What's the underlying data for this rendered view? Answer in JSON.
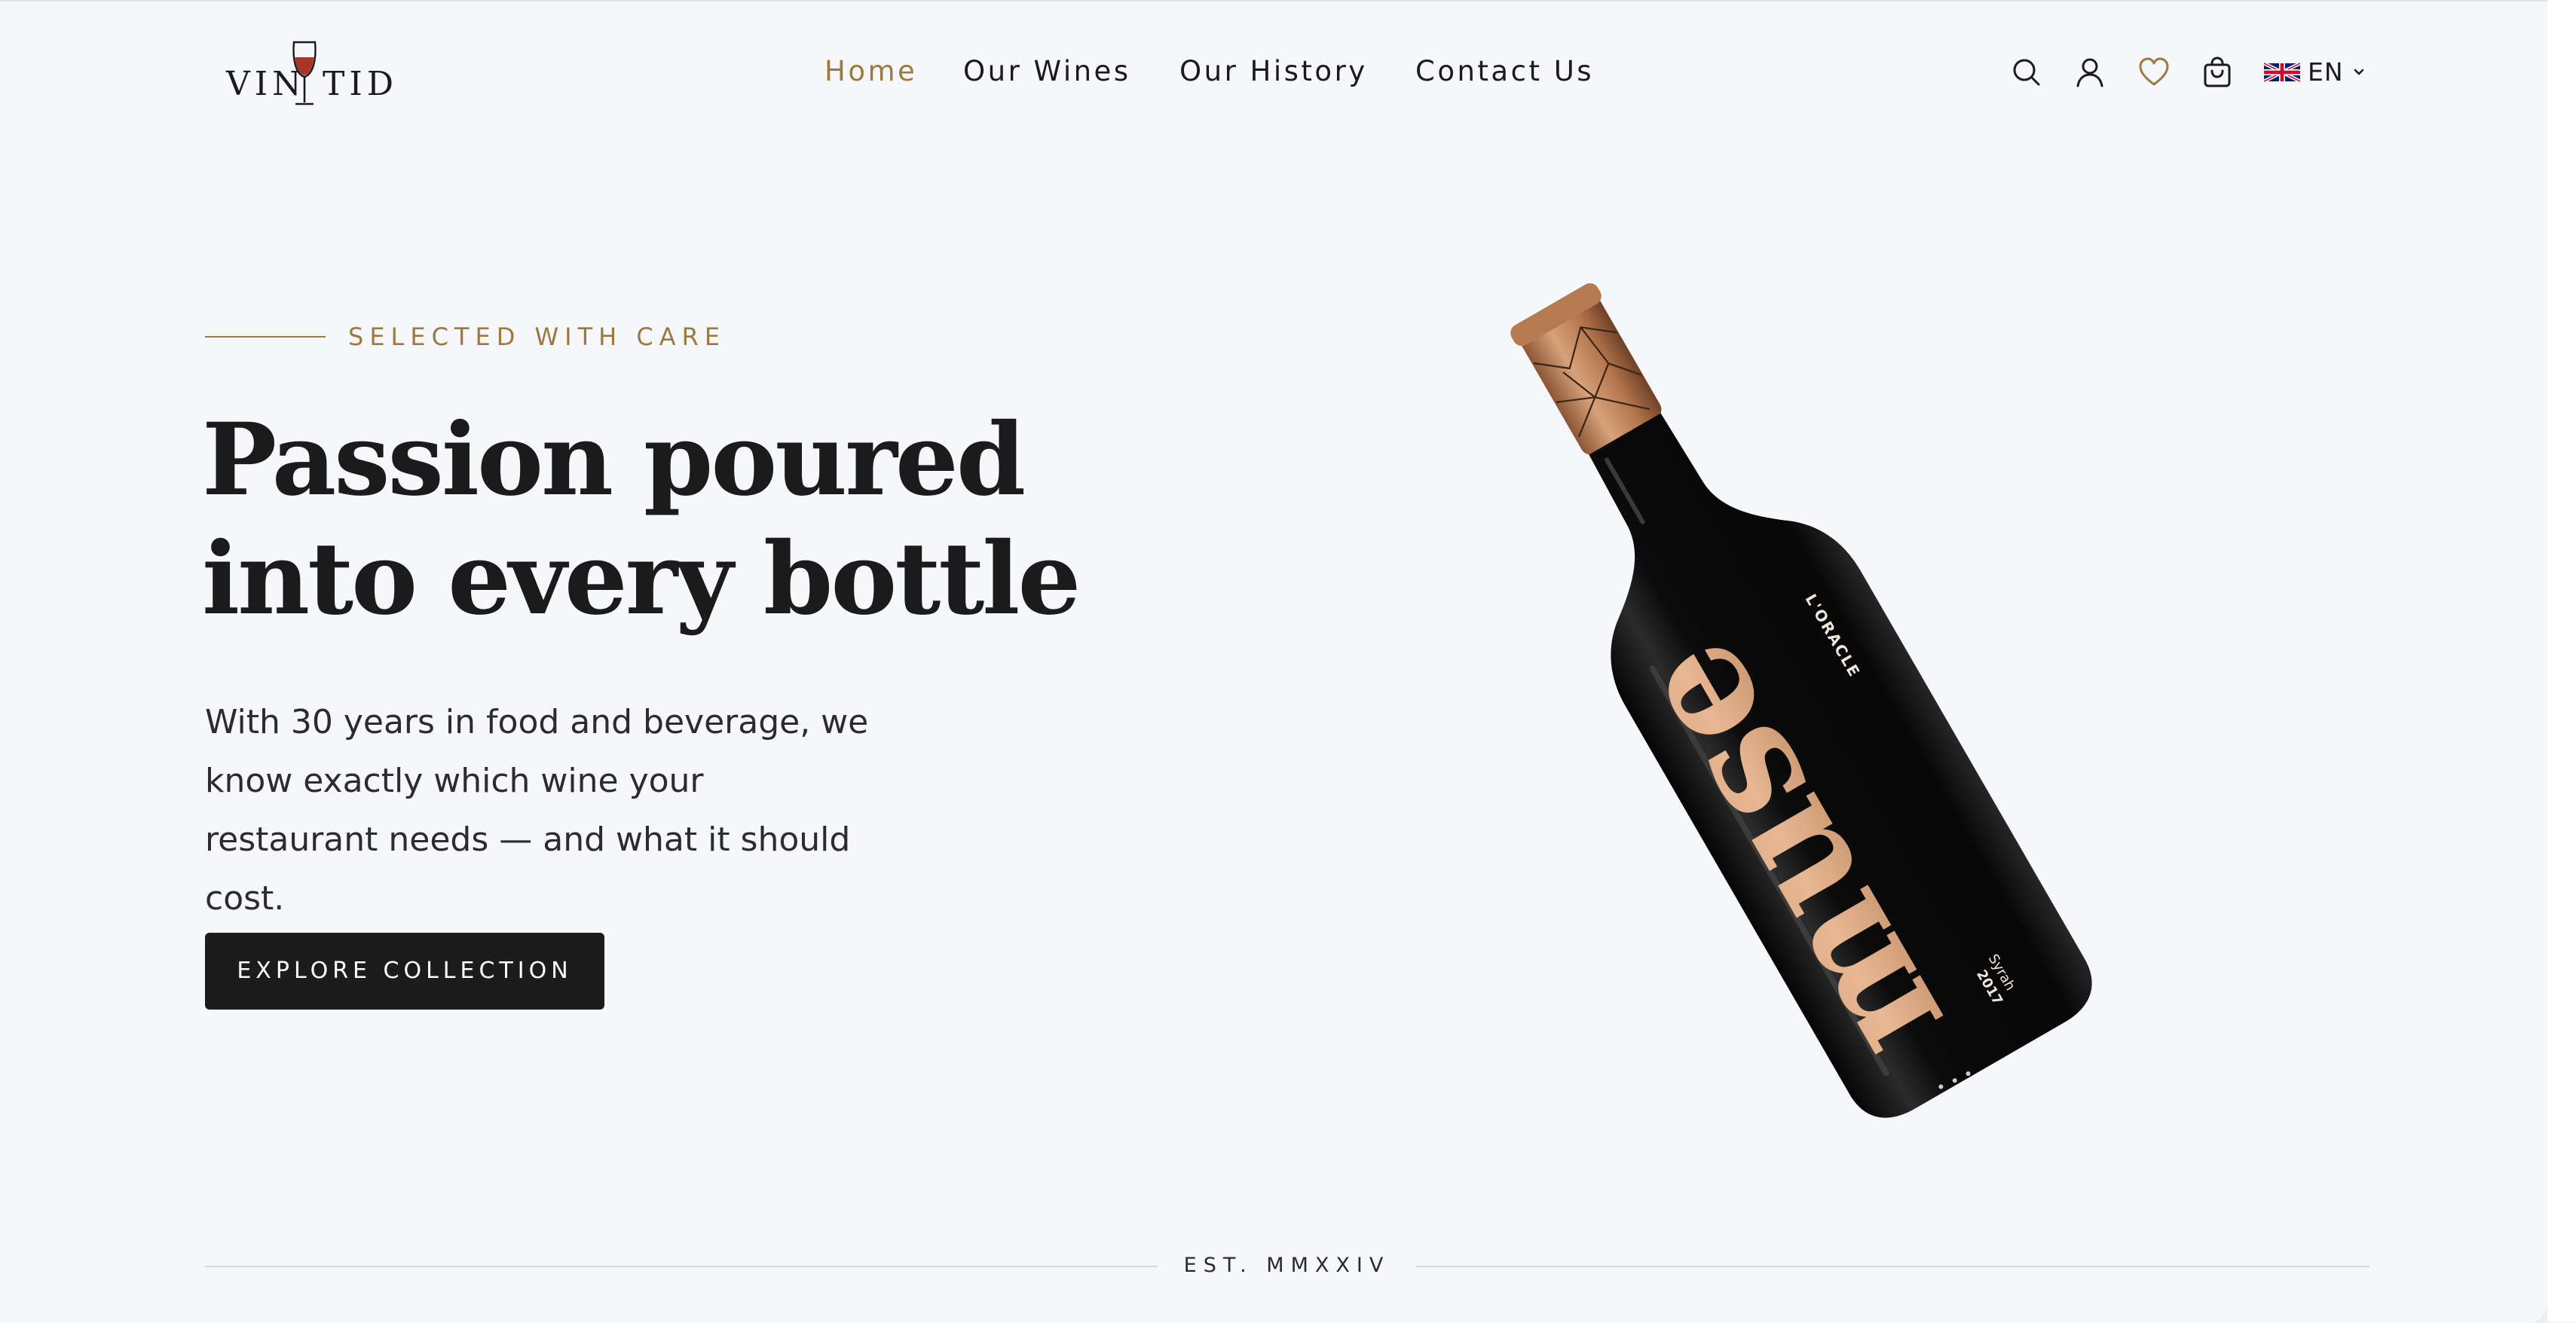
{
  "brand": {
    "logo_left": "VIN",
    "logo_right": "TID"
  },
  "nav": {
    "items": [
      {
        "label": "Home",
        "active": true
      },
      {
        "label": "Our Wines",
        "active": false
      },
      {
        "label": "Our History",
        "active": false
      },
      {
        "label": "Contact Us",
        "active": false
      }
    ]
  },
  "header_icons": [
    "search-icon",
    "user-icon",
    "heart-icon",
    "shopping-bag-icon"
  ],
  "language": {
    "code": "EN",
    "flag": "uk-flag-icon"
  },
  "hero": {
    "eyebrow": "SELECTED WITH CARE",
    "headline_line1": "Passion poured",
    "headline_line2": "into every bottle",
    "lead": "With 30 years in food and beverage, we know exactly which wine your restaurant needs — and what it should cost.",
    "cta_label": "EXPLORE COLLECTION"
  },
  "bottle_label": {
    "name": "muse",
    "maker": "L'ORACLE",
    "variety": "Syrah",
    "year": "2017"
  },
  "footer": {
    "est": "EST. MMXXIV"
  },
  "colors": {
    "accent_gold": "#9c7a3f",
    "text_dark": "#1b1b1b",
    "background": "#f6f7fa",
    "button_bg": "#1c1c1c",
    "copper": "#c8946a"
  }
}
